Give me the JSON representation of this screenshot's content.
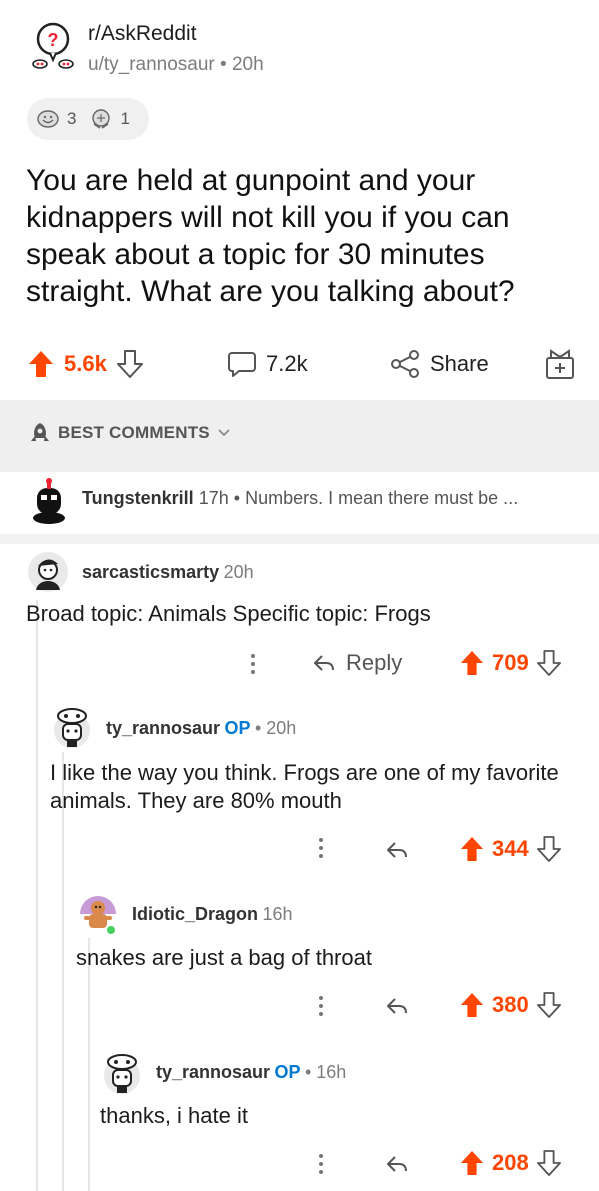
{
  "post": {
    "subreddit": "r/AskReddit",
    "author": "u/ty_rannosaur",
    "time": "20h",
    "awards": [
      {
        "icon": "laughing-award-icon",
        "count": "3"
      },
      {
        "icon": "wholesome-award-icon",
        "count": "1"
      }
    ],
    "title": "You are held at gunpoint and your kidnappers will not kill you if you can speak about a topic for 30 minutes straight. What are you talking about?",
    "upvotes": "5.6k",
    "comments": "7.2k",
    "share_label": "Share"
  },
  "sort": {
    "label": "BEST COMMENTS"
  },
  "collapsed_comment": {
    "user": "Tungstenkrill",
    "time": "17h",
    "preview": "Numbers. I mean there must be ..."
  },
  "comments": [
    {
      "user": "sarcasticsmarty",
      "time": "20h",
      "body": "Broad topic: Animals Specific topic: Frogs",
      "reply_label": "Reply",
      "score": "709"
    },
    {
      "user": "ty_rannosaur",
      "op": "OP",
      "time": "20h",
      "body": "I like the way you think. Frogs are one of my favorite animals. They are 80% mouth",
      "score": "344"
    },
    {
      "user": "Idiotic_Dragon",
      "time": "16h",
      "body": "snakes are just a bag of throat",
      "score": "380"
    },
    {
      "user": "ty_rannosaur",
      "op": "OP",
      "time": "16h",
      "body": "thanks, i hate it",
      "score": "208"
    }
  ],
  "colors": {
    "upvote": "#ff4500",
    "op": "#0079d3",
    "online": "#46d160"
  }
}
